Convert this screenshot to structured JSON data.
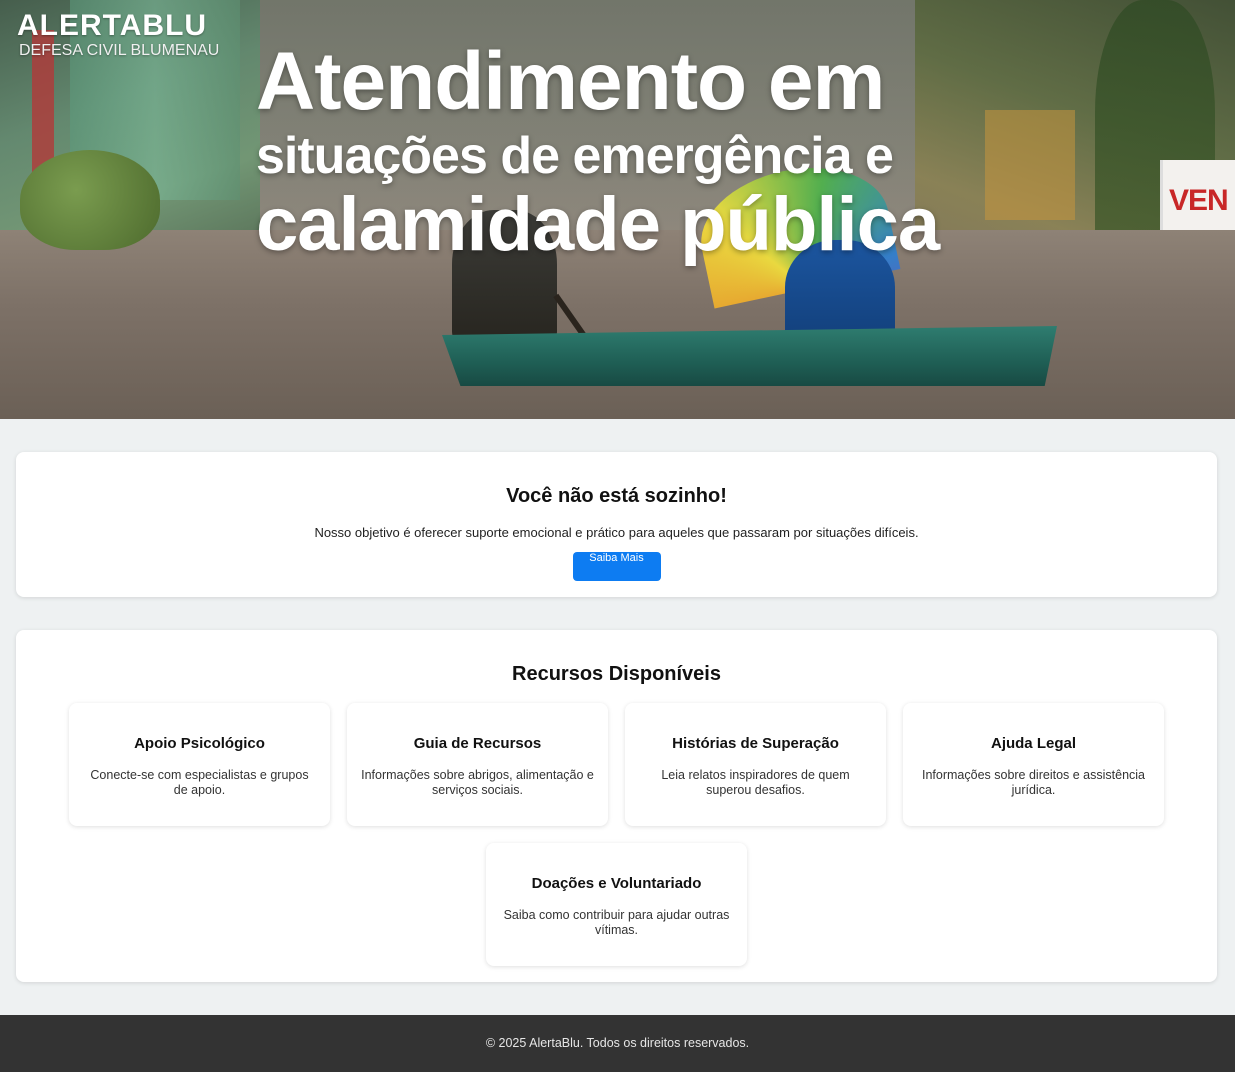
{
  "brand": {
    "name": "ALERTABLU",
    "subtitle": "DEFESA CIVIL BLUMENAU"
  },
  "hero": {
    "line1": "Atendimento em",
    "line2": "situações de emergência e",
    "line3": "calamidade pública",
    "sign_text": "VEN"
  },
  "support": {
    "title": "Você não está sozinho!",
    "text": "Nosso objetivo é oferecer suporte emocional e prático para aqueles que passaram por situações difíceis.",
    "button_label": "Saiba Mais"
  },
  "resources": {
    "title": "Recursos Disponíveis",
    "items": [
      {
        "title": "Apoio Psicológico",
        "text": "Conecte-se com especialistas e grupos de apoio."
      },
      {
        "title": "Guia de Recursos",
        "text": "Informações sobre abrigos, alimentação e serviços sociais."
      },
      {
        "title": "Histórias de Superação",
        "text": "Leia relatos inspiradores de quem superou desafios."
      },
      {
        "title": "Ajuda Legal",
        "text": "Informações sobre direitos e assistência jurídica."
      },
      {
        "title": "Doações e Voluntariado",
        "text": "Saiba como contribuir para ajudar outras vítimas."
      }
    ]
  },
  "footer": {
    "text": "© 2025 AlertaBlu. Todos os direitos reservados."
  },
  "colors": {
    "primary_button": "#0d7cf2",
    "footer_bg": "#333333",
    "page_bg": "#eef1f2"
  }
}
